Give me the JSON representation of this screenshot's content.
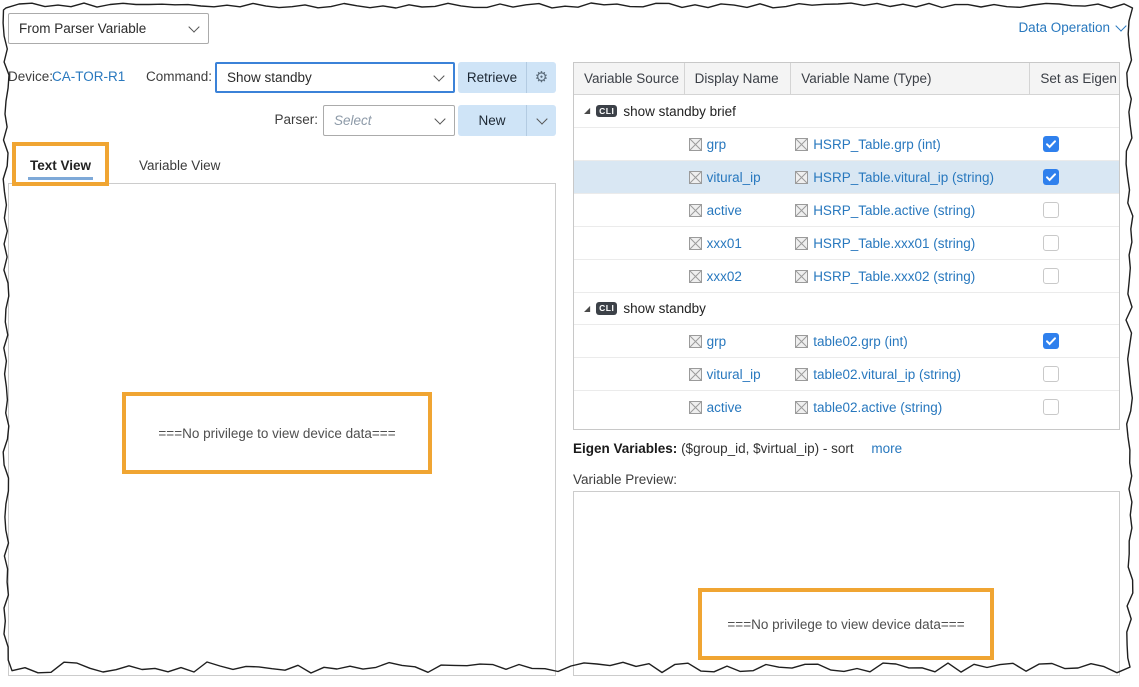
{
  "source_select": {
    "value": "From Parser Variable"
  },
  "data_operation": {
    "label": "Data Operation"
  },
  "device": {
    "label": "Device:",
    "name": "CA-TOR-R1"
  },
  "command": {
    "label": "Command:",
    "value": "Show standby"
  },
  "retrieve": {
    "label": "Retrieve"
  },
  "parser": {
    "label": "Parser:",
    "placeholder": "Select"
  },
  "new_button": {
    "label": "New"
  },
  "tabs": [
    {
      "label": "Text View",
      "active": true
    },
    {
      "label": "Variable View",
      "active": false
    }
  ],
  "left_panel": {
    "message": "===No privilege to view device data==="
  },
  "table": {
    "columns": [
      "Variable Source",
      "Display Name",
      "Variable Name (Type)",
      "Set as Eigen"
    ],
    "groups": [
      {
        "badge": "CLI",
        "label": "show standby brief",
        "rows": [
          {
            "display": "grp",
            "variable": "HSRP_Table.grp (int)",
            "eigen": true,
            "selected": false
          },
          {
            "display": "vitural_ip",
            "variable": "HSRP_Table.vitural_ip (string)",
            "eigen": true,
            "selected": true
          },
          {
            "display": "active",
            "variable": "HSRP_Table.active (string)",
            "eigen": false,
            "selected": false
          },
          {
            "display": "xxx01",
            "variable": "HSRP_Table.xxx01 (string)",
            "eigen": false,
            "selected": false
          },
          {
            "display": "xxx02",
            "variable": "HSRP_Table.xxx02 (string)",
            "eigen": false,
            "selected": false
          }
        ]
      },
      {
        "badge": "CLI",
        "label": "show standby",
        "rows": [
          {
            "display": "grp",
            "variable": "table02.grp (int)",
            "eigen": true,
            "selected": false
          },
          {
            "display": "vitural_ip",
            "variable": "table02.vitural_ip (string)",
            "eigen": false,
            "selected": false
          },
          {
            "display": "active",
            "variable": "table02.active (string)",
            "eigen": false,
            "selected": false
          }
        ]
      }
    ]
  },
  "eigen": {
    "label": "Eigen Variables:",
    "value": "($group_id, $virtual_ip) - sort",
    "more_label": "more"
  },
  "preview": {
    "label": "Variable Preview:",
    "message": "===No privilege to view device data==="
  },
  "colors": {
    "accent_blue": "#2878be",
    "checkbox_blue": "#2f80ed",
    "annotation_orange": "#f0a532",
    "selected_row": "#d9e7f3",
    "button_bg": "#cfe4f7"
  }
}
